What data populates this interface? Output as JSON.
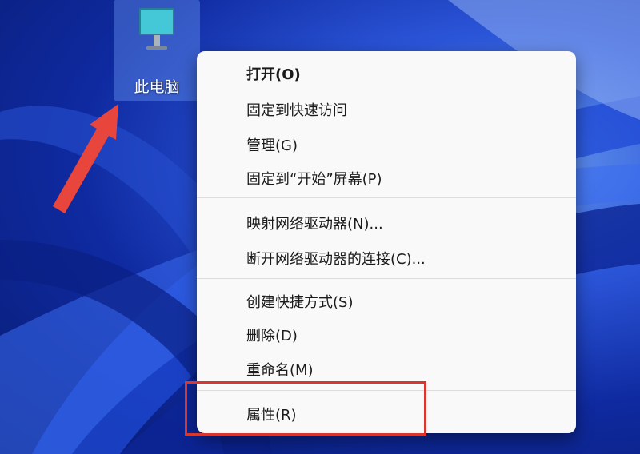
{
  "desktop": {
    "icon_label": "此电脑",
    "icon_name": "this-pc-icon"
  },
  "context_menu": {
    "groups": [
      [
        {
          "label": "打开(O)",
          "bold": true
        },
        {
          "label": "固定到快速访问"
        },
        {
          "label": "管理(G)"
        },
        {
          "label": "固定到“开始”屏幕(P)"
        }
      ],
      [
        {
          "label": "映射网络驱动器(N)..."
        },
        {
          "label": "断开网络驱动器的连接(C)..."
        }
      ],
      [
        {
          "label": "创建快捷方式(S)"
        },
        {
          "label": "删除(D)"
        },
        {
          "label": "重命名(M)"
        }
      ],
      [
        {
          "label": "属性(R)"
        }
      ]
    ]
  },
  "annotations": {
    "arrow_color": "#e8453c",
    "highlight_color": "#d9362f"
  }
}
